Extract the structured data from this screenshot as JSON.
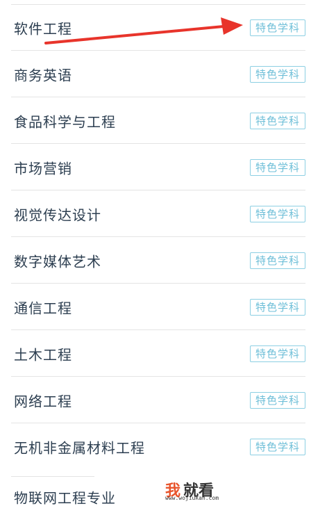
{
  "badge_label": "特色学科",
  "items": [
    {
      "name": "软件工程",
      "badge": "特色学科"
    },
    {
      "name": "商务英语",
      "badge": "特色学科"
    },
    {
      "name": "食品科学与工程",
      "badge": "特色学科"
    },
    {
      "name": "市场营销",
      "badge": "特色学科"
    },
    {
      "name": "视觉传达设计",
      "badge": "特色学科"
    },
    {
      "name": "数字媒体艺术",
      "badge": "特色学科"
    },
    {
      "name": "通信工程",
      "badge": "特色学科"
    },
    {
      "name": "土木工程",
      "badge": "特色学科"
    },
    {
      "name": "网络工程",
      "badge": "特色学科"
    },
    {
      "name": "无机非金属材料工程",
      "badge": "特色学科"
    },
    {
      "name": "物联网工程专业"
    }
  ],
  "annotation": {
    "arrow_color": "#e8342b",
    "points_to": "特色学科"
  },
  "watermark": {
    "wo": "我",
    "rest": "就看",
    "url": "www.wojiukan.com"
  },
  "colors": {
    "label": "#2c3e50",
    "badge_text": "#6fbfd8",
    "badge_border": "#8ccfe3",
    "divider": "#e4e4e4"
  }
}
